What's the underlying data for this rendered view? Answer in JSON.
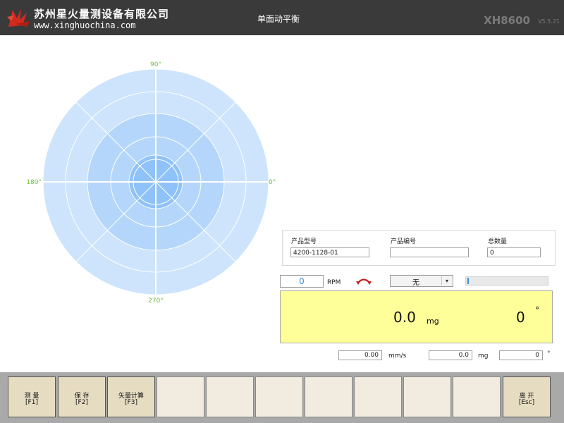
{
  "header": {
    "company_name": "苏州星火量测设备有限公司",
    "website": "www.xinghuochina.com",
    "title": "单面动平衡",
    "model": "XH8600",
    "version": "V5.5.21"
  },
  "polar_chart": {
    "labels": {
      "top": "90°",
      "left": "180°",
      "right": "0°",
      "bottom": "270°"
    },
    "colors": {
      "outer": "#cde4fc",
      "middle": "#b4d6fb",
      "inner": "#8fc2f9",
      "axis_label": "#6cbf3a"
    }
  },
  "product": {
    "model_label": "产品型号",
    "model_value": "4200-1128-01",
    "serial_label": "产品编号",
    "serial_value": "",
    "total_label": "总数量",
    "total_value": "0"
  },
  "speed": {
    "rpm_value": "0",
    "rpm_unit": "RPM",
    "rotation_icon": "rotation-direction-icon",
    "mode_select_value": "无",
    "progress": 0.0
  },
  "readout": {
    "amplitude": "0.0",
    "amplitude_unit": "mg",
    "angle": "0",
    "angle_unit": "°",
    "background": "#ffff99"
  },
  "measurements": {
    "velocity_value": "0.00",
    "velocity_unit": "mm/s",
    "mg_value": "0.0",
    "mg_unit": "mg",
    "angle_value": "0",
    "angle_unit": "°"
  },
  "function_bar": {
    "measure": {
      "label": "测 量",
      "key": "[F1]"
    },
    "save": {
      "label": "保 存",
      "key": "[F2]"
    },
    "vector": {
      "label": "矢量计算",
      "key": "[F3]"
    },
    "exit": {
      "label": "离 开",
      "key": "[Esc]"
    }
  }
}
